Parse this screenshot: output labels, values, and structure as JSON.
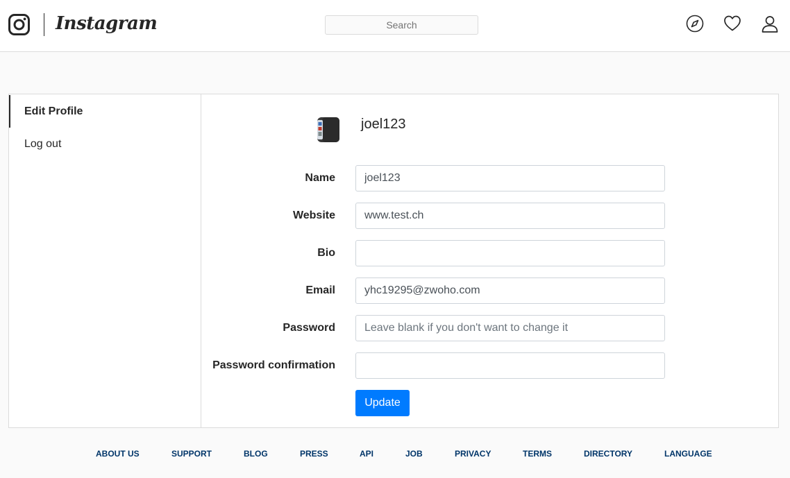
{
  "header": {
    "logo_icon": "instagram-glyph-icon",
    "wordmark": "Instagram",
    "search_placeholder": "Search",
    "icons": [
      "compass-icon",
      "heart-icon",
      "user-icon"
    ]
  },
  "sidebar": {
    "items": [
      {
        "label": "Edit Profile",
        "active": true
      },
      {
        "label": "Log out",
        "active": false
      }
    ]
  },
  "profile": {
    "username": "joel123",
    "avatar_icon": "phone-avatar-icon"
  },
  "form": {
    "fields": [
      {
        "label": "Name",
        "value": "joel123",
        "placeholder": ""
      },
      {
        "label": "Website",
        "value": "www.test.ch",
        "placeholder": ""
      },
      {
        "label": "Bio",
        "value": "",
        "placeholder": ""
      },
      {
        "label": "Email",
        "value": "yhc19295@zwoho.com",
        "placeholder": ""
      },
      {
        "label": "Password",
        "value": "",
        "placeholder": "Leave blank if you don't want to change it"
      },
      {
        "label": "Password confirmation",
        "value": "",
        "placeholder": ""
      }
    ],
    "submit_label": "Update"
  },
  "footer": {
    "links": [
      "About us",
      "Support",
      "Blog",
      "Press",
      "API",
      "Job",
      "Privacy",
      "Terms",
      "Directory",
      "Language"
    ]
  },
  "colors": {
    "accent": "#007bff",
    "footer_link": "#003569",
    "border": "#dbdbdb",
    "background": "#fafafa"
  }
}
